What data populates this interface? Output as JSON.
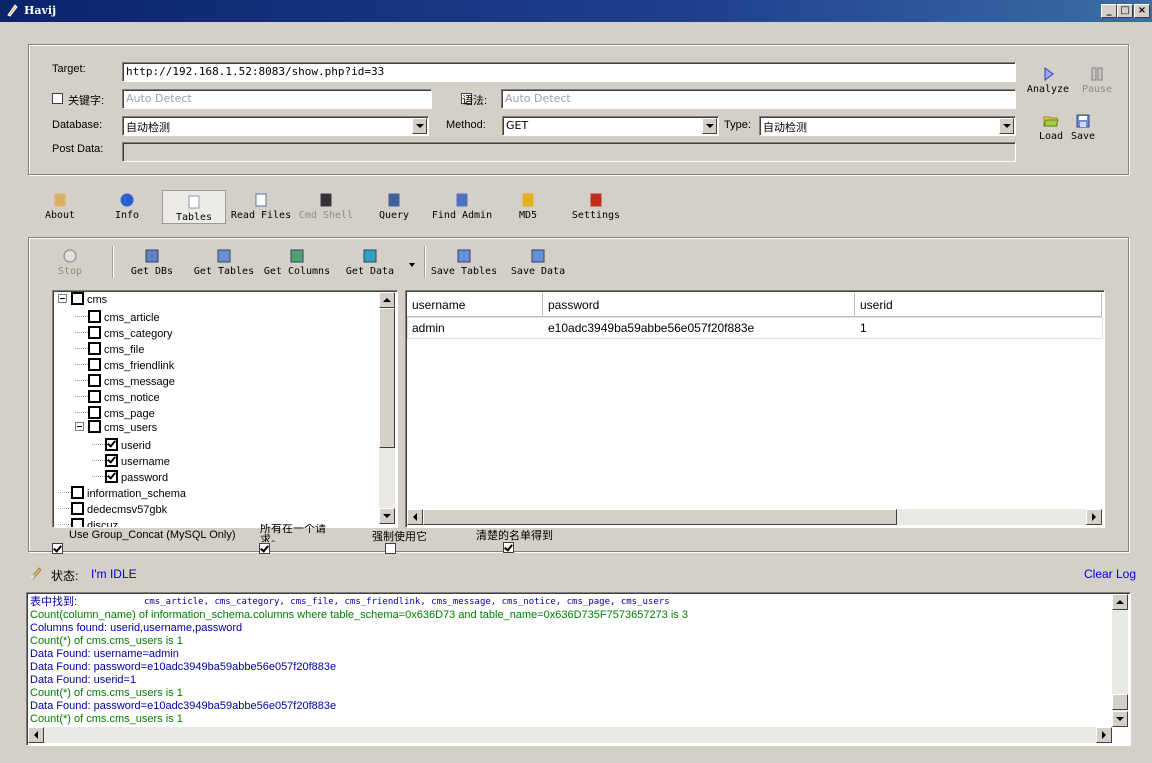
{
  "window": {
    "title": "Havij"
  },
  "target": {
    "target_label": "Target:",
    "target_value": "http://192.168.1.52:8083/show.php?id=33",
    "keyword_label": "关键字:",
    "keyword_placeholder": "Auto Detect",
    "syntax_label": "语法:",
    "syntax_placeholder": "Auto Detect",
    "database_label": "Database:",
    "database_value": "自动检测",
    "method_label": "Method:",
    "method_value": "GET",
    "type_label": "Type:",
    "type_value": "自动检测",
    "postdata_label": "Post Data:"
  },
  "actions": {
    "analyze": "Analyze",
    "pause": "Pause",
    "load": "Load",
    "save": "Save"
  },
  "nav": [
    {
      "label": "About",
      "icon": "about-icon"
    },
    {
      "label": "Info",
      "icon": "info-icon"
    },
    {
      "label": "Tables",
      "icon": "tables-icon"
    },
    {
      "label": "Read Files",
      "icon": "read-files-icon"
    },
    {
      "label": "Cmd Shell",
      "icon": "cmd-shell-icon"
    },
    {
      "label": "Query",
      "icon": "query-icon"
    },
    {
      "label": "Find Admin",
      "icon": "find-admin-icon"
    },
    {
      "label": "MD5",
      "icon": "md5-icon"
    },
    {
      "label": "Settings",
      "icon": "settings-icon"
    }
  ],
  "toolbar": {
    "stop": "Stop",
    "get_dbs": "Get DBs",
    "get_tables": "Get Tables",
    "get_columns": "Get Columns",
    "get_data": "Get Data",
    "save_tables": "Save Tables",
    "save_data": "Save Data"
  },
  "tree": [
    {
      "label": "cms",
      "checked": false
    },
    {
      "label": "cms_article",
      "checked": false
    },
    {
      "label": "cms_category",
      "checked": false
    },
    {
      "label": "cms_file",
      "checked": false
    },
    {
      "label": "cms_friendlink",
      "checked": false
    },
    {
      "label": "cms_message",
      "checked": false
    },
    {
      "label": "cms_notice",
      "checked": false
    },
    {
      "label": "cms_page",
      "checked": false
    },
    {
      "label": "cms_users",
      "checked": false
    },
    {
      "label": "userid",
      "checked": true
    },
    {
      "label": "username",
      "checked": true
    },
    {
      "label": "password",
      "checked": true
    },
    {
      "label": "information_schema",
      "checked": false
    },
    {
      "label": "dedecmsv57gbk",
      "checked": false
    },
    {
      "label": "discuz",
      "checked": false
    }
  ],
  "grid": {
    "columns": [
      "username",
      "password",
      "userid"
    ],
    "rows": [
      [
        "admin",
        "e10adc3949ba59abbe56e057f20f883e",
        "1"
      ]
    ]
  },
  "options": {
    "group_concat": "Use Group_Concat (MySQL Only)",
    "all_in_one": "所有在一个请求。",
    "force": "强制使用它",
    "clear_list": "清楚的名单得到"
  },
  "status": {
    "label": "状态:",
    "value": "I'm IDLE",
    "clear_log": "Clear Log"
  },
  "log": [
    {
      "text": "表中找到:",
      "color": "#0000a0"
    },
    {
      "text": "Count(column_name) of information_schema.columns where table_schema=0x636D73 and table_name=0x636D735F7573657273 is 3",
      "color": "#008000"
    },
    {
      "text": "Columns found: userid,username,password",
      "color": "#0000a0"
    },
    {
      "text": "Count(*) of cms.cms_users is 1",
      "color": "#008000"
    },
    {
      "text": "Data Found: username=admin",
      "color": "#0000a0"
    },
    {
      "text": "Data Found: password=e10adc3949ba59abbe56e057f20f883e",
      "color": "#0000a0"
    },
    {
      "text": "Data Found: userid=1",
      "color": "#0000a0"
    },
    {
      "text": "Count(*) of cms.cms_users is 1",
      "color": "#008000"
    },
    {
      "text": "Data Found: password=e10adc3949ba59abbe56e057f20f883e",
      "color": "#0000a0"
    },
    {
      "text": "Count(*) of cms.cms_users is 1",
      "color": "#008000"
    }
  ],
  "log_tables": "cms_article, cms_category, cms_file, cms_friendlink, cms_message, cms_notice, cms_page, cms_users"
}
